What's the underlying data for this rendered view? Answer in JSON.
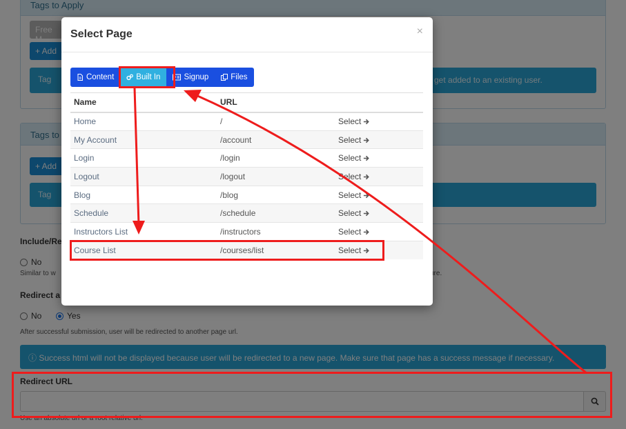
{
  "background": {
    "panel1": {
      "header": "Tags to Apply",
      "free_button": "Free M",
      "add_button": "+ Add",
      "info_text": "Tag",
      "info_text_right": "l get added to an existing user."
    },
    "panel2": {
      "header": "Tags to",
      "add_button": "+ Add",
      "info_text": "Tag"
    },
    "include": {
      "label": "Include/Re",
      "option_no": "No",
      "help": "Similar to w",
      "help_right": "ure."
    },
    "redirect": {
      "label": "Redirect a",
      "option_no": "No",
      "option_yes": "Yes",
      "help": "After successful submission, user will be redirected to another page url."
    },
    "redirect_info": "Success html will not be displayed because user will be redirected to a new page. Make sure that page has a success message if necessary.",
    "redirect_url": {
      "label": "Redirect URL",
      "value": "",
      "help": "Use an absolute url or a root relative url."
    }
  },
  "modal": {
    "title": "Select Page",
    "close": "×",
    "tabs": [
      {
        "label": "Content",
        "icon": "file-icon",
        "active": false
      },
      {
        "label": "Built In",
        "icon": "gears-icon",
        "active": true
      },
      {
        "label": "Signup",
        "icon": "id-card-icon",
        "active": false
      },
      {
        "label": "Files",
        "icon": "copy-icon",
        "active": false
      }
    ],
    "columns": [
      "Name",
      "URL",
      ""
    ],
    "rows": [
      {
        "name": "Home",
        "url": "/",
        "action": "Select"
      },
      {
        "name": "My Account",
        "url": "/account",
        "action": "Select"
      },
      {
        "name": "Login",
        "url": "/login",
        "action": "Select"
      },
      {
        "name": "Logout",
        "url": "/logout",
        "action": "Select"
      },
      {
        "name": "Blog",
        "url": "/blog",
        "action": "Select"
      },
      {
        "name": "Schedule",
        "url": "/schedule",
        "action": "Select"
      },
      {
        "name": "Instructors List",
        "url": "/instructors",
        "action": "Select"
      },
      {
        "name": "Course List",
        "url": "/courses/list",
        "action": "Select"
      }
    ]
  },
  "colors": {
    "annotation": "#ee1c1c",
    "tab": "#1a4fe0",
    "tab_active": "#30b0e0",
    "info": "#2aa6d8"
  }
}
